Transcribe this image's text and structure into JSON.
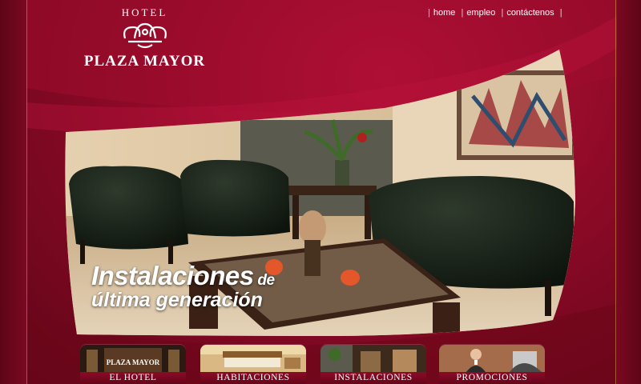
{
  "brand": {
    "top_line": "HOTEL",
    "name": "PLAZA MAYOR"
  },
  "nav": {
    "items": [
      "home",
      "empleo",
      "contáctenos"
    ]
  },
  "hero": {
    "headline_main": "Instalaciones",
    "headline_de": " de",
    "headline_sub": "última generación"
  },
  "tabs": [
    {
      "label": "EL HOTEL",
      "thumb_text": "PLAZA MAYOR"
    },
    {
      "label": "HABITACIONES"
    },
    {
      "label": "INSTALACIONES"
    },
    {
      "label": "PROMOCIONES"
    }
  ],
  "colors": {
    "brand_red": "#8e0a27",
    "accent_gold": "#d8a24a"
  }
}
